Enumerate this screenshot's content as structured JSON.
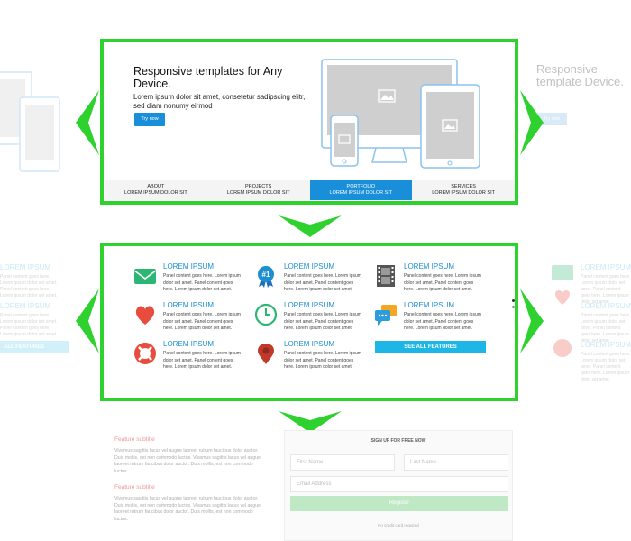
{
  "hero": {
    "title": "Responsive templates for Any Device.",
    "subtitle": "Lorem ipsum dolor sit amet, consetetur sadipscing elitr, sed diam nonumy eirmod",
    "cta": "Try now",
    "ghost_title": "Responsive template Device.",
    "ghost_cta": "Try now"
  },
  "nav": [
    {
      "label": "ABOUT",
      "sub": "LOREM IPSUM DOLOR SIT"
    },
    {
      "label": "PROJECTS",
      "sub": "LOREM IPSUM DOLOR SIT"
    },
    {
      "label": "PORTFOLIO",
      "sub": "LOREM IPSUM DOLOR SIT"
    },
    {
      "label": "SERVICES",
      "sub": "LOREM IPSUM DOLOR SIT"
    }
  ],
  "features": {
    "heading": "LOREM IPSUM",
    "body": "Panel content goes here. Lorem ipsum dolor set amet. Panel content goes here. Lorem ipsum dolor set amet.",
    "see_all": "SEE ALL FEATURES",
    "ghost_see_all": "ALL FEATURES",
    "ghost_heading": "LOREM IPSUM",
    "ghost_heading_right": "LOREM IPSUM"
  },
  "bottom": {
    "feature_subtitle": "Feature subtitle",
    "feature_text": "Vivamus sagittis lacus vel augue laoreet rutrum faucibus dolor auctor. Duis mollis, est non commodo luctus. Vivamus sagittis lacus vel augue laoreet rutrum faucibus dolor auctor. Duis mollis, est non commodo luctus.",
    "form_title": "SIGN UP FOR FREE NOW",
    "first_name": "First Name",
    "last_name": "Last Name",
    "email": "Email Address",
    "register": "Register",
    "note": "No credit card required"
  },
  "colors": {
    "frame": "#2fd12f",
    "accent": "#1a8fd9",
    "see_all": "#1db6e5"
  }
}
